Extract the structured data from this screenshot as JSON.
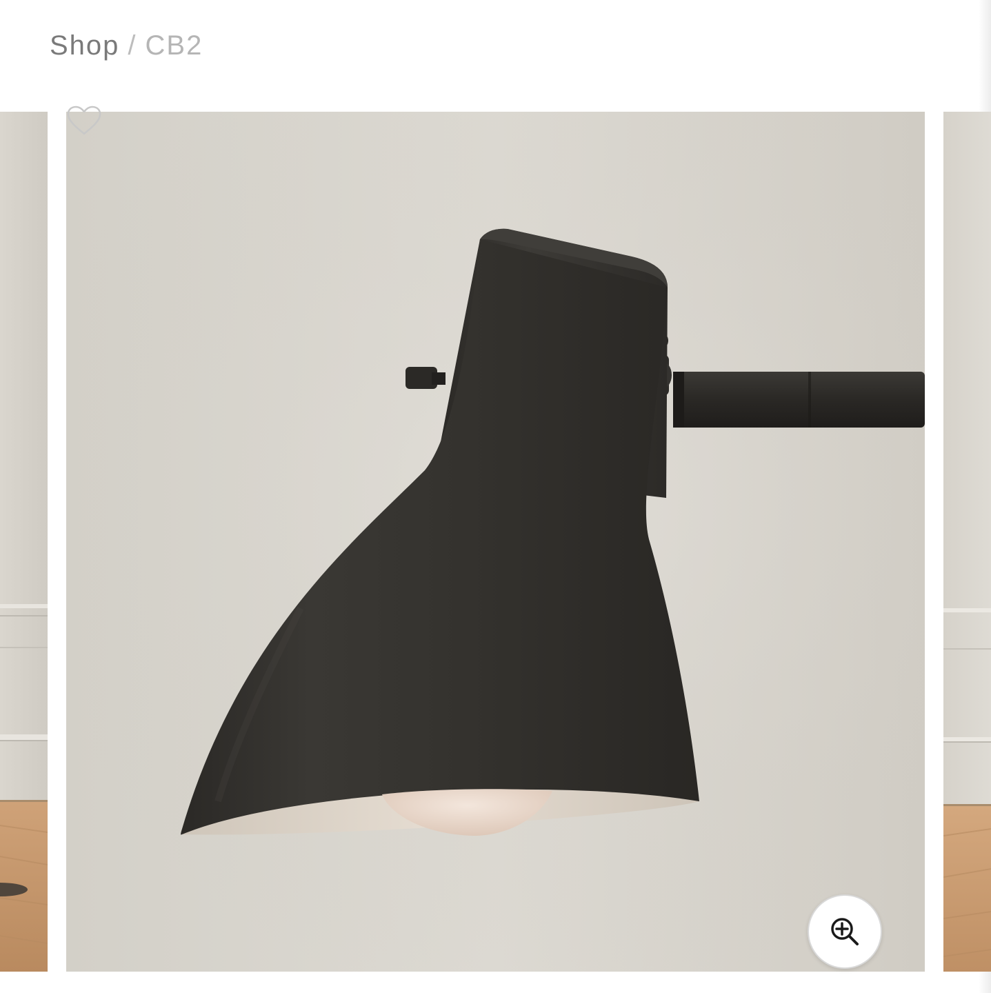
{
  "breadcrumb": {
    "shop": "Shop",
    "separator": "/",
    "brand": "CB2"
  },
  "gallery": {
    "wishlist_icon": "heart-outline-icon",
    "zoom_icon": "zoom-in-icon",
    "colors": {
      "wall": "#d4d1ca",
      "shade": "#33312d",
      "floor": "#c99c6e",
      "bulb": "#ecdcd0"
    }
  }
}
